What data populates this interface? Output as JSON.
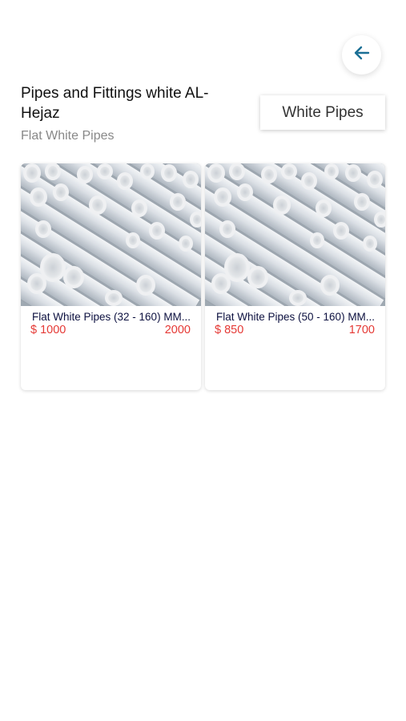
{
  "header": {
    "back_icon": "arrow-left-icon",
    "title": "Pipes and Fittings white AL-Hejaz",
    "subtitle": "Flat White Pipes",
    "category_chip": "White Pipes"
  },
  "colors": {
    "accent": "#1b6f95",
    "price": "#e53935",
    "product_name": "#0d1140",
    "subtitle": "#888888"
  },
  "products": [
    {
      "name": "Flat White Pipes (32 - 160) MM...",
      "price": "$ 1000",
      "old_price": "2000",
      "image_icon": "white-pipes-photo"
    },
    {
      "name": "Flat White Pipes (50 - 160) MM...",
      "price": "$ 850",
      "old_price": "1700",
      "image_icon": "white-pipes-photo"
    }
  ]
}
